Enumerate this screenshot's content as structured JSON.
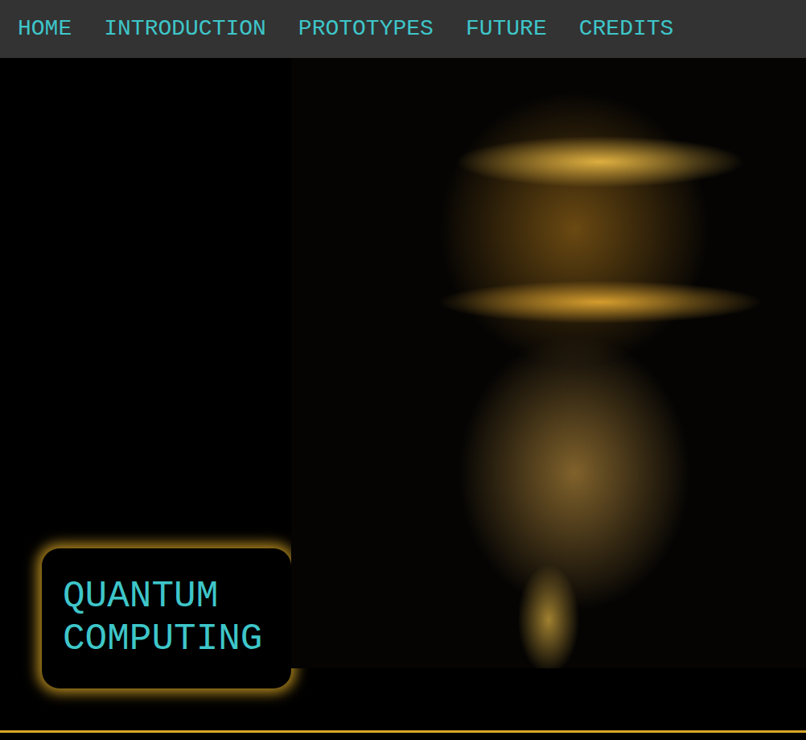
{
  "nav": {
    "items": [
      {
        "label": "HOME"
      },
      {
        "label": "INTRODUCTION"
      },
      {
        "label": "PROTOTYPES"
      },
      {
        "label": "FUTURE"
      },
      {
        "label": "CREDITS"
      }
    ]
  },
  "hero": {
    "title": "QUANTUM COMPUTING"
  }
}
